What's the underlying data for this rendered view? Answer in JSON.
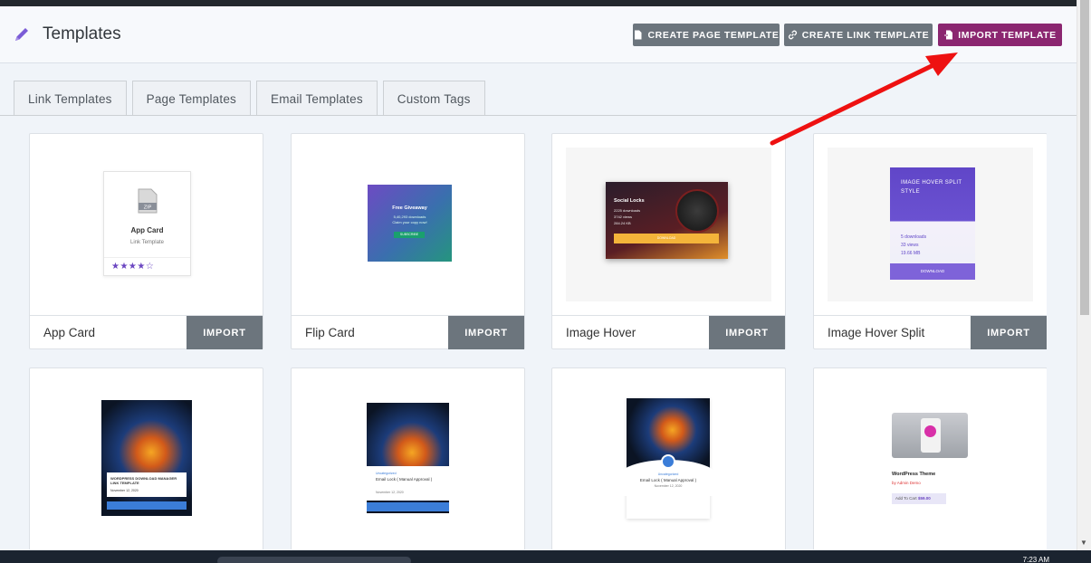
{
  "header": {
    "title": "Templates",
    "buttons": {
      "create_page": "CREATE PAGE TEMPLATE",
      "create_link": "CREATE LINK TEMPLATE",
      "import": "IMPORT TEMPLATE"
    }
  },
  "tabs": [
    {
      "label": "Link Templates"
    },
    {
      "label": "Page Templates"
    },
    {
      "label": "Email Templates"
    },
    {
      "label": "Custom Tags"
    }
  ],
  "import_label": "IMPORT",
  "cards": [
    {
      "name": "App Card"
    },
    {
      "name": "Flip Card"
    },
    {
      "name": "Image Hover"
    },
    {
      "name": "Image Hover Split"
    }
  ],
  "thumbs": {
    "app_card": {
      "icon_text": "ZIP",
      "title": "App Card",
      "subtitle": "Link Template",
      "stars": "★★★★☆"
    },
    "flip_card": {
      "title": "Free Giveaway",
      "line1": "5,40,293 downloads",
      "line2": "Claim your copy now!",
      "button": "SUBSCRIBE"
    },
    "image_hover": {
      "title": "Social Locks",
      "l1": "2225 downloads",
      "l2": "3742 views",
      "l3": "284.24 KB",
      "button": "DOWNLOAD"
    },
    "image_hover_split": {
      "title": "IMAGE HOVER SPLIT STYLE",
      "l1": "5 downloads",
      "l2": "33 views",
      "l3": "19.66 MB",
      "button": "DOWNLOAD"
    },
    "wp1": {
      "title": "WORDPRESS DOWNLOAD MANAGER LINK TEMPLATE",
      "date": "November 12, 2020"
    },
    "wp2": {
      "cat": "Uncategorized",
      "title": "Email Lock ( Manual Approval )",
      "date": "November 12, 2020"
    },
    "wp3": {
      "cat": "Uncategorized",
      "title": "Email Lock ( Manual Approval )",
      "date": "November 12, 2020"
    },
    "shop": {
      "title": "WordPress Theme",
      "author": "by Admin Demo",
      "cart": "Add To Cart",
      "price": "$59.00"
    }
  },
  "colors": {
    "accent": "#8b2670",
    "button_gray": "#6c757d",
    "arrow": "#ee1111"
  },
  "taskbar": {
    "clock": "7:23 AM"
  }
}
